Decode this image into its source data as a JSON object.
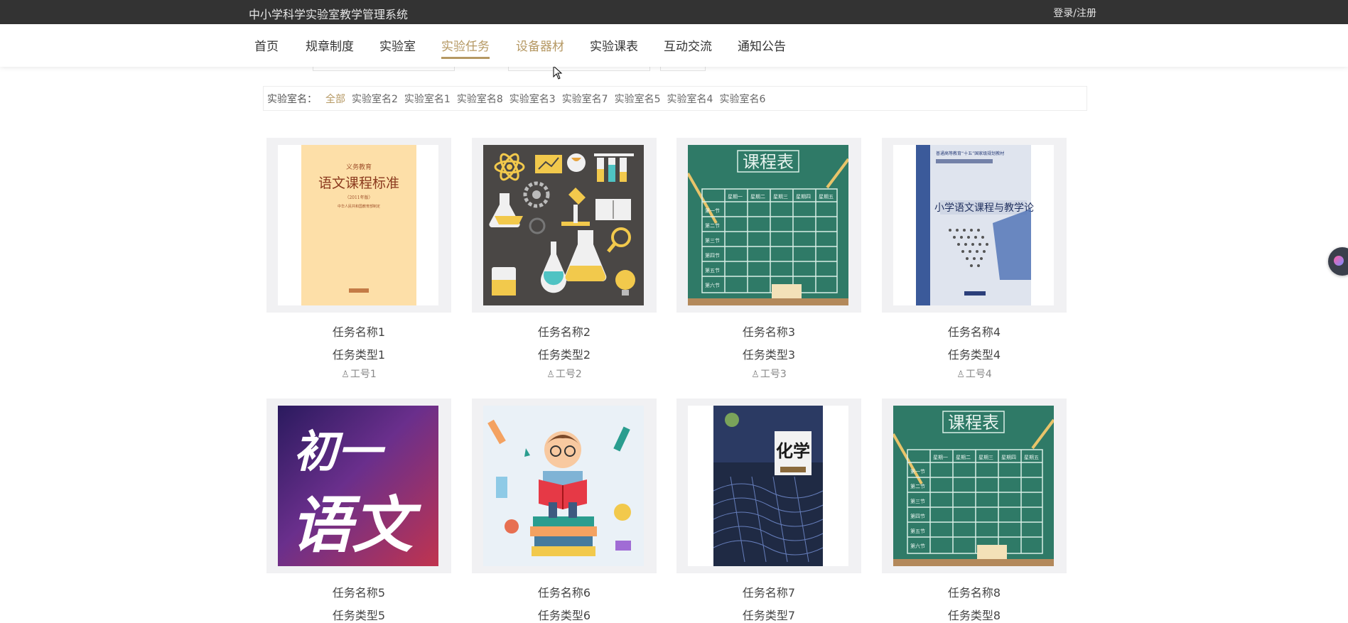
{
  "header": {
    "site_title": "中小学科学实验室教学管理系统",
    "login_label": "登录/注册"
  },
  "nav": {
    "items": [
      "首页",
      "规章制度",
      "实验室",
      "实验任务",
      "设备器材",
      "实验课表",
      "互动交流",
      "通知公告"
    ],
    "active": "实验任务"
  },
  "filter": {
    "label": "实验室名：",
    "options": [
      "全部",
      "实验室名2",
      "实验室名1",
      "实验室名8",
      "实验室名3",
      "实验室名7",
      "实验室名5",
      "实验室名4",
      "实验室名6"
    ],
    "selected": "全部"
  },
  "cards": [
    {
      "name": "任务名称1",
      "type": "任务类型1",
      "worker": "工号1",
      "image": "语文课程标准 book cover"
    },
    {
      "name": "任务名称2",
      "type": "任务类型2",
      "worker": "工号2",
      "image": "science lab icons"
    },
    {
      "name": "任务名称3",
      "type": "任务类型3",
      "worker": "工号3",
      "image": "课程表 chalkboard"
    },
    {
      "name": "任务名称4",
      "type": "任务类型4",
      "worker": "工号4",
      "image": "小学语文课程与教学论 book cover"
    },
    {
      "name": "任务名称5",
      "type": "任务类型5",
      "worker": "",
      "image": "初一语文 purple cover"
    },
    {
      "name": "任务名称6",
      "type": "任务类型6",
      "worker": "",
      "image": "boy reading illustration"
    },
    {
      "name": "任务名称7",
      "type": "任务类型7",
      "worker": "",
      "image": "化学 textbook cover"
    },
    {
      "name": "任务名称8",
      "type": "任务类型8",
      "worker": "",
      "image": "课程表 chalkboard"
    }
  ],
  "images": {
    "book1": {
      "top": "义务教育",
      "title": "语文课程标准",
      "sub": "（2011年版）",
      "pub": "中华人民共和国教育部制定"
    },
    "chalk": {
      "title": "课程表",
      "days": [
        "星期一",
        "星期二",
        "星期三",
        "星期四",
        "星期五"
      ],
      "periods": [
        "第一节",
        "第二节",
        "第三节",
        "第四节",
        "第五节",
        "第六节"
      ]
    },
    "book2": {
      "series": "普通高等教育“十五”国家级规划教材",
      "title": "小学语文课程与教学论"
    },
    "cover5": {
      "line1": "初一",
      "line2": "语文"
    },
    "cover7": {
      "title": "化学"
    }
  },
  "colors": {
    "accent": "#b59863",
    "topbar": "#333333",
    "chalkboard": "#2f7a67"
  }
}
